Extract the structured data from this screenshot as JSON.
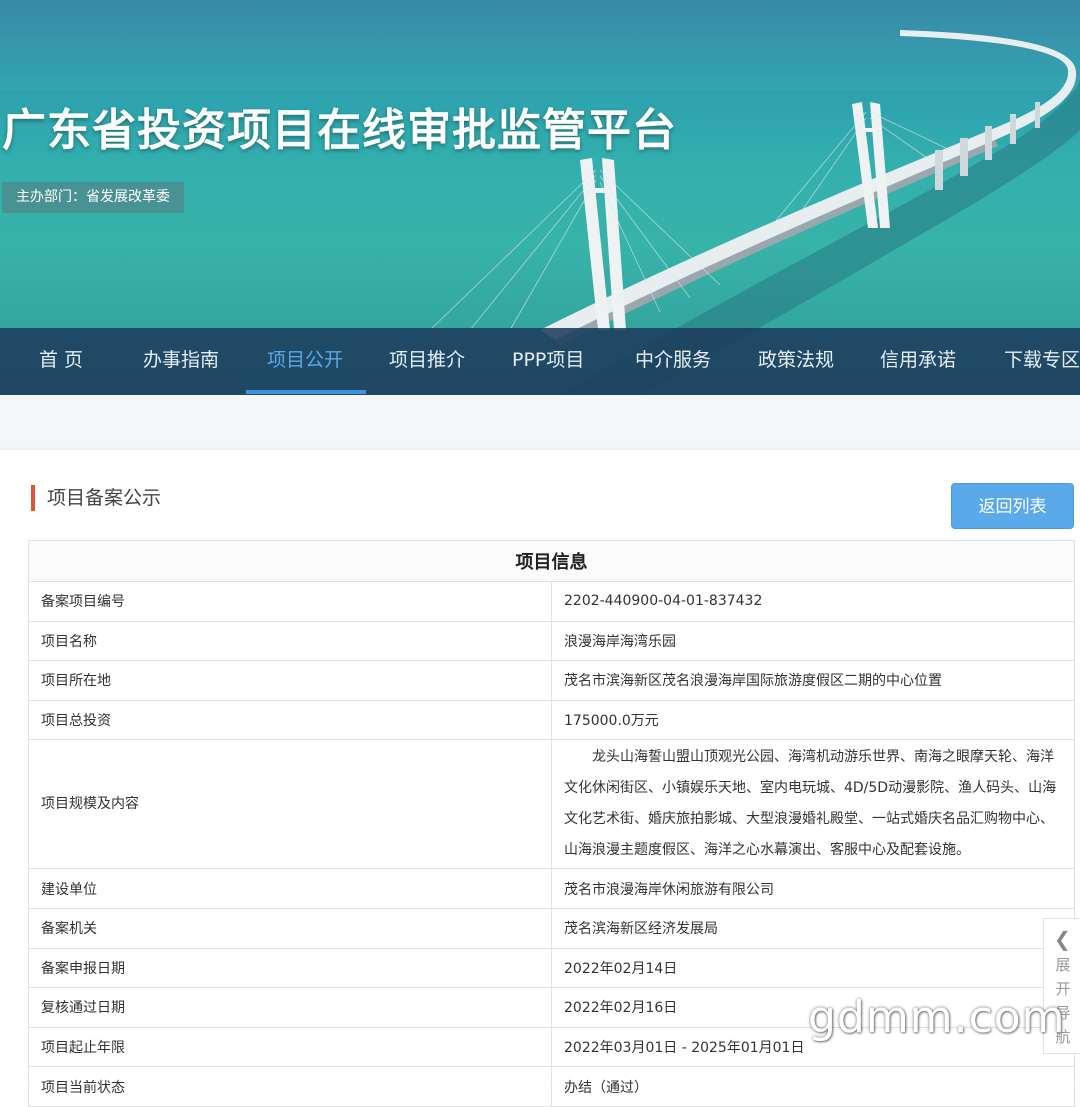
{
  "header": {
    "site_title": "广东省投资项目在线审批监管平台",
    "sponsor": "主办部门：省发展改革委"
  },
  "nav": {
    "items": [
      "首 页",
      "办事指南",
      "项目公开",
      "项目推介",
      "PPP项目",
      "中介服务",
      "政策法规",
      "信用承诺",
      "下载专区"
    ],
    "active": "项目公开"
  },
  "section": {
    "title": "项目备案公示",
    "back_button": "返回列表"
  },
  "table": {
    "heading": "项目信息",
    "rows": [
      {
        "label": "备案项目编号",
        "value": "2202-440900-04-01-837432"
      },
      {
        "label": "项目名称",
        "value": "浪漫海岸海湾乐园"
      },
      {
        "label": "项目所在地",
        "value": "茂名市滨海新区茂名浪漫海岸国际旅游度假区二期的中心位置"
      },
      {
        "label": "项目总投资",
        "value": "175000.0万元"
      },
      {
        "label": "项目规模及内容",
        "value": "龙头山海誓山盟山顶观光公园、海湾机动游乐世界、南海之眼摩天轮、海洋文化休闲街区、小镇娱乐天地、室内电玩城、4D/5D动漫影院、渔人码头、山海文化艺术街、婚庆旅拍影城、大型浪漫婚礼殿堂、一站式婚庆名品汇购物中心、山海浪漫主题度假区、海洋之心水幕演出、客服中心及配套设施。"
      },
      {
        "label": "建设单位",
        "value": "茂名市浪漫海岸休闲旅游有限公司"
      },
      {
        "label": "备案机关",
        "value": "茂名滨海新区经济发展局"
      },
      {
        "label": "备案申报日期",
        "value": "2022年02月14日"
      },
      {
        "label": "复核通过日期",
        "value": "2022年02月16日"
      },
      {
        "label": "项目起止年限",
        "value": "2022年03月01日 - 2025年01月01日"
      },
      {
        "label": "项目当前状态",
        "value": "办结（通过）"
      }
    ]
  },
  "side_nav": {
    "label": "展开导航",
    "icon": "chevron-left-icon"
  },
  "watermark": "gdmm.com",
  "colors": {
    "nav_active": "#59a9ea",
    "button": "#5aa9ea",
    "section_mark": "#e2543a",
    "navbar_bg": "#1c3c5c"
  }
}
